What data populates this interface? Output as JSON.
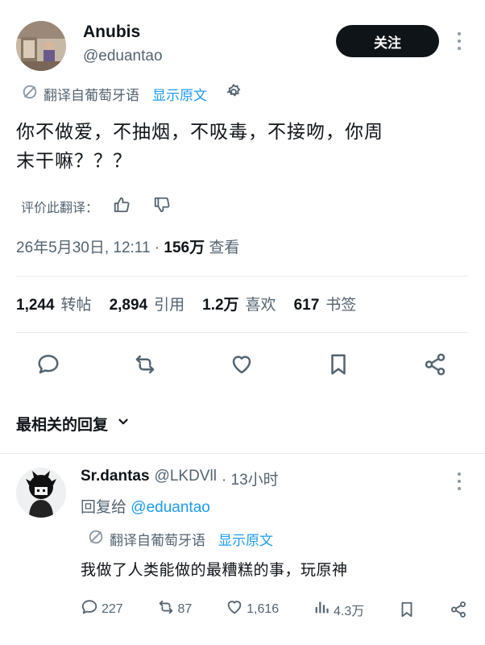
{
  "post": {
    "author_name": "Anubis",
    "author_handle": "@eduantao",
    "follow_label": "关注",
    "translate_label": "翻译自葡萄牙语",
    "show_original_label": "显示原文",
    "text_line1": "你不做爱，不抽烟，不吸毒，不接吻，你周",
    "text_line2": "末干嘛？？？",
    "rate_label": "评价此翻译：",
    "timestamp": "26年5月30日, 12:11 · ",
    "views_count": "156万",
    "views_label": " 查看",
    "stats": {
      "retweets_count": "1,244",
      "retweets_label": "转帖",
      "quotes_count": "2,894",
      "quotes_label": "引用",
      "likes_count": "1.2万",
      "likes_label": "喜欢",
      "bookmarks_count": "617",
      "bookmarks_label": "书签"
    }
  },
  "replies_section": {
    "title": "最相关的回复"
  },
  "reply": {
    "author_name": "Sr.dantas",
    "author_handle": "@LKDVll",
    "time": "· 13小时",
    "reply_to_label": "回复给",
    "reply_to_handle": "@eduantao",
    "translate_label": "翻译自葡萄牙语",
    "show_original_label": "显示原文",
    "text": "我做了人类能做的最糟糕的事，玩原神",
    "replies_count": "227",
    "retweets_count": "87",
    "likes_count": "1,616",
    "views_count": "4.3万"
  },
  "colors": {
    "accent": "#1d9bf0",
    "text": "#0f1419",
    "muted": "#536471",
    "button": "#0f1419"
  },
  "icons": [
    "no-translate-icon",
    "gear-icon",
    "thumbs-up-icon",
    "thumbs-down-icon",
    "reply-icon",
    "retweet-icon",
    "like-icon",
    "bookmark-icon",
    "share-icon",
    "chevron-down-icon",
    "more-icon",
    "views-icon"
  ]
}
